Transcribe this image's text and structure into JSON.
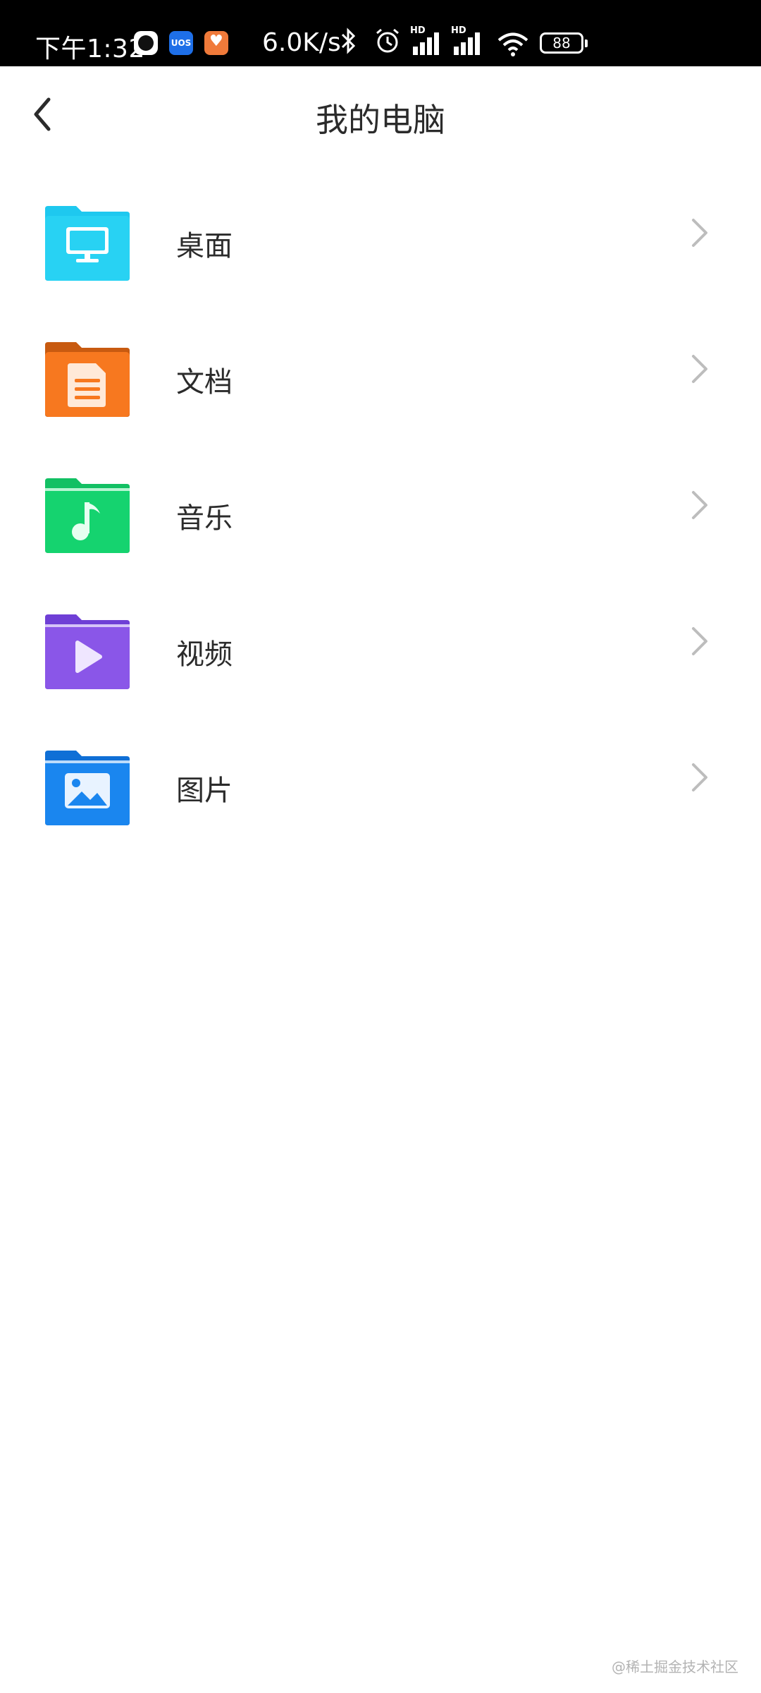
{
  "status_bar": {
    "time": "下午1:32",
    "net_speed": "6.0K/s",
    "battery": "88",
    "uos_label": "UOS",
    "hd_label": "HD",
    "icons": [
      "record-icon",
      "uos-app-icon",
      "health-app-icon",
      "bluetooth-icon",
      "alarm-icon",
      "signal-icon",
      "wifi-icon",
      "battery-icon"
    ]
  },
  "header": {
    "title": "我的电脑",
    "back_icon": "back-arrow-icon"
  },
  "items": [
    {
      "label": "桌面",
      "icon": "folder-desktop-icon",
      "color": "#1ec8ef"
    },
    {
      "label": "文档",
      "icon": "folder-document-icon",
      "color": "#f7781f"
    },
    {
      "label": "音乐",
      "icon": "folder-music-icon",
      "color": "#15d36f"
    },
    {
      "label": "视频",
      "icon": "folder-video-icon",
      "color": "#8a56e8"
    },
    {
      "label": "图片",
      "icon": "folder-picture-icon",
      "color": "#1a86ef"
    }
  ],
  "watermark": "@稀土掘金技术社区"
}
